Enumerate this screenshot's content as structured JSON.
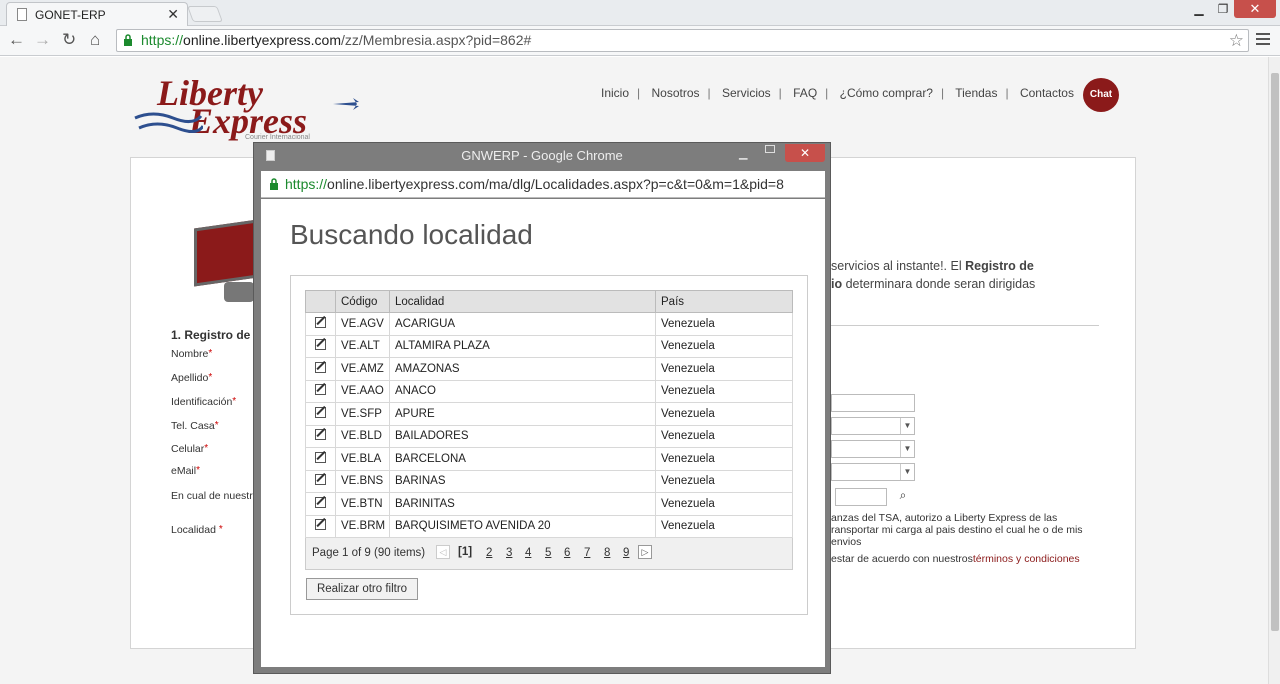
{
  "browser": {
    "tab_title": "GONET-ERP",
    "url_proto": "https://",
    "url_host": "online.libertyexpress.com",
    "url_path": "/zz/Membresia.aspx?pid=862#"
  },
  "site": {
    "logo_line1": "Liberty",
    "logo_line2": "Express",
    "logo_tagline": "Courier Internacional",
    "nav": [
      "Inicio",
      "Nosotros",
      "Servicios",
      "FAQ",
      "¿Cómo comprar?",
      "Tiendas",
      "Contactos"
    ],
    "chat_label": "Chat",
    "section_title": "1. Registro de",
    "fields": [
      "Nombre",
      "Apellido",
      "Identificación",
      "Tel. Casa",
      "Celular",
      "eMail",
      "En cual de nuestra",
      "Localidad"
    ],
    "intro_text_a": "servicios al instante!. El ",
    "intro_text_b": "Registro de",
    "intro_text_c": "io",
    "intro_text_d": " determinara donde seran dirigidas",
    "tsa_text": "anzas del TSA, autorizo a Liberty Express de las ransportar mi carga al pais destino el cual he o de mis envios",
    "terms_text": "estar de acuerdo con nuestros",
    "terms_link": "términos y condiciones"
  },
  "popup": {
    "window_title": "GNWERP - Google Chrome",
    "url_proto": "https://",
    "url_rest": "online.libertyexpress.com/ma/dlg/Localidades.aspx?p=c&t=0&m=1&pid=8",
    "heading": "Buscando localidad",
    "columns": [
      "",
      "Código",
      "Localidad",
      "País"
    ],
    "rows": [
      [
        "VE.AGV",
        "ACARIGUA",
        "Venezuela"
      ],
      [
        "VE.ALT",
        "ALTAMIRA PLAZA",
        "Venezuela"
      ],
      [
        "VE.AMZ",
        "AMAZONAS",
        "Venezuela"
      ],
      [
        "VE.AAO",
        "ANACO",
        "Venezuela"
      ],
      [
        "VE.SFP",
        "APURE",
        "Venezuela"
      ],
      [
        "VE.BLD",
        "BAILADORES",
        "Venezuela"
      ],
      [
        "VE.BLA",
        "BARCELONA",
        "Venezuela"
      ],
      [
        "VE.BNS",
        "BARINAS",
        "Venezuela"
      ],
      [
        "VE.BTN",
        "BARINITAS",
        "Venezuela"
      ],
      [
        "VE.BRM",
        "BARQUISIMETO AVENIDA 20",
        "Venezuela"
      ]
    ],
    "pager_info": "Page 1 of 9 (90 items)",
    "current_page": "[1]",
    "pages": [
      "2",
      "3",
      "4",
      "5",
      "6",
      "7",
      "8",
      "9"
    ],
    "refilter_label": "Realizar otro filtro"
  }
}
